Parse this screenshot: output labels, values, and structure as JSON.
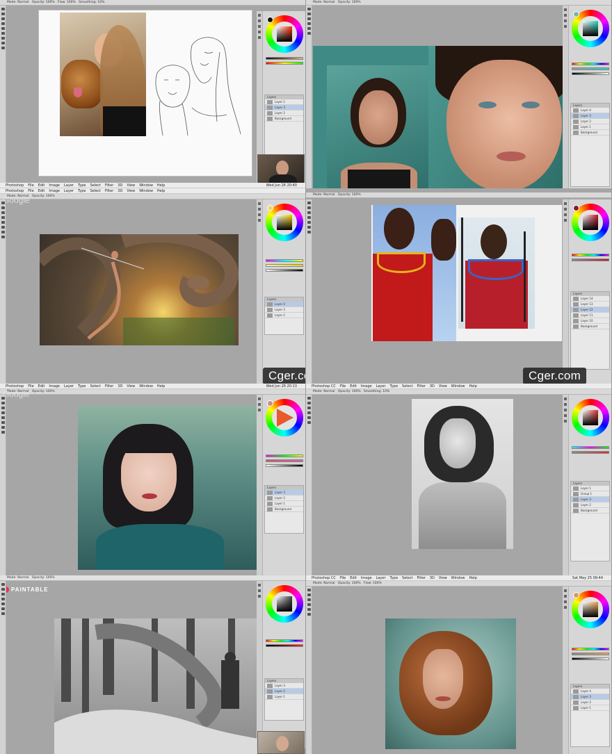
{
  "menubar": {
    "items": [
      "Photoshop",
      "File",
      "Edit",
      "Image",
      "Layer",
      "Type",
      "Select",
      "Filter",
      "3D",
      "View",
      "Window",
      "Help"
    ],
    "items_dc": [
      "Photoshop CC",
      "File",
      "Edit",
      "Image",
      "Layer",
      "Type",
      "Select",
      "Filter",
      "3D",
      "View",
      "Window",
      "Help"
    ],
    "clock_a": "Wed Jun 26 20:40",
    "clock_b": "Wed Jun 26 20:13",
    "clock_c": "Sat May 25 09:44"
  },
  "optbar": {
    "mode_label": "Mode",
    "mode_value": "Normal",
    "opacity_label": "Opacity",
    "opacity_value": "100%",
    "flow_label": "Flow",
    "flow_value": "100%",
    "smoothing_label": "Smoothing",
    "smoothing_value": "10%"
  },
  "panels_text": {
    "google": "Google",
    "paintable": "PAINTABLE"
  },
  "watermarks": {
    "left": "Cger.com",
    "right": "Cger.com"
  },
  "layers": {
    "header": "Layers",
    "panel1": [
      "Layer 1",
      "Layer 3",
      "Layer 2",
      "Background"
    ],
    "panel2": [
      "Layer 4",
      "Layer 3",
      "Layer 2",
      "Layer 1",
      "Background"
    ],
    "panel3": [
      "Layer 4",
      "Layer 3",
      "Layer 2"
    ],
    "panel4": [
      "Layer 14",
      "Layer 13",
      "Layer 12",
      "Layer 11",
      "Layer 10",
      "Background"
    ],
    "panel5": [
      "Layer 3",
      "Layer 2",
      "Layer 1",
      "Background"
    ],
    "panel6": [
      "Layer 1",
      "Group 1",
      "Layer 3",
      "Layer 2",
      "Background"
    ],
    "panel7": [
      "Layer 3",
      "Layer 2",
      "Layer 1"
    ],
    "panel8": [
      "Layer 4",
      "Layer 3",
      "Layer 2",
      "Layer 1"
    ]
  },
  "colors": {
    "ps_chrome": "#d6d6d6",
    "workspace": "#a6a6a6",
    "watermark_bg": "#1e1e1e",
    "paintable_accent": "#e8345a"
  },
  "icons": [
    "color-wheel-icon",
    "brush-tool-icon",
    "eye-icon",
    "layer-thumbnail-icon"
  ]
}
